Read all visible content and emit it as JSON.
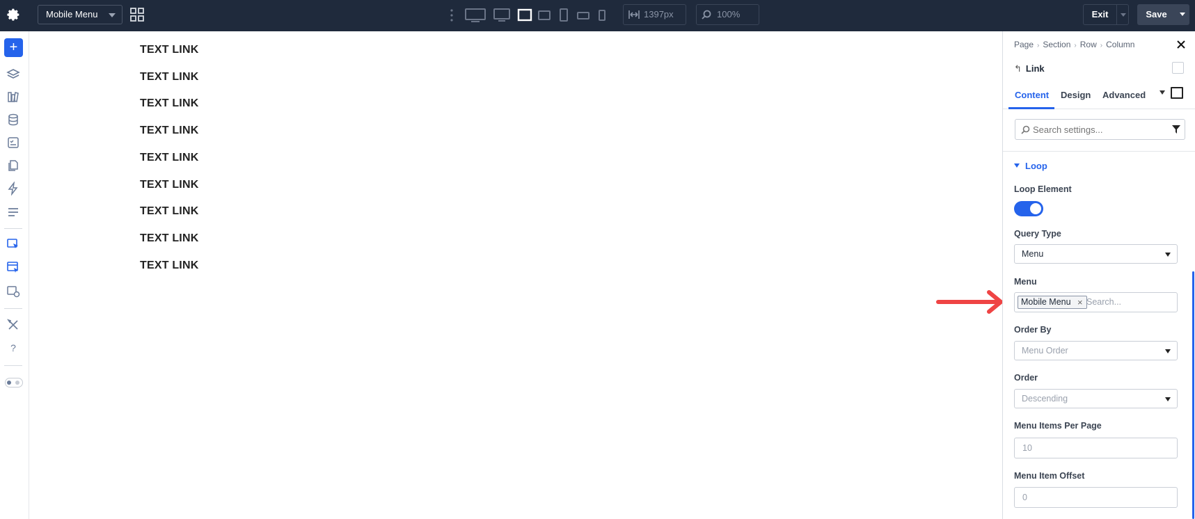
{
  "topbar": {
    "template_select": "Mobile Menu",
    "width_value": "1397px",
    "zoom_value": "100%",
    "exit_label": "Exit",
    "save_label": "Save"
  },
  "canvas": {
    "links": [
      "TEXT LINK",
      "TEXT LINK",
      "TEXT LINK",
      "TEXT LINK",
      "TEXT LINK",
      "TEXT LINK",
      "TEXT LINK",
      "TEXT LINK",
      "TEXT LINK"
    ]
  },
  "panel": {
    "breadcrumb": [
      "Page",
      "Section",
      "Row",
      "Column"
    ],
    "element_title": "Link",
    "tabs": [
      "Content",
      "Design",
      "Advanced"
    ],
    "search_placeholder": "Search settings...",
    "section_title": "Loop",
    "loop_element_label": "Loop Element",
    "loop_element_on": true,
    "query_type_label": "Query Type",
    "query_type_value": "Menu",
    "menu_label": "Menu",
    "menu_tag": "Mobile Menu",
    "menu_search_placeholder": "Search...",
    "order_by_label": "Order By",
    "order_by_value": "Menu Order",
    "order_label": "Order",
    "order_value": "Descending",
    "items_per_page_label": "Menu Items Per Page",
    "items_per_page_value": "10",
    "item_offset_label": "Menu Item Offset",
    "item_offset_value": "0"
  },
  "colors": {
    "topbar_bg": "#1f2a3c",
    "accent": "#2563eb",
    "annotation_arrow": "#ef4444"
  }
}
